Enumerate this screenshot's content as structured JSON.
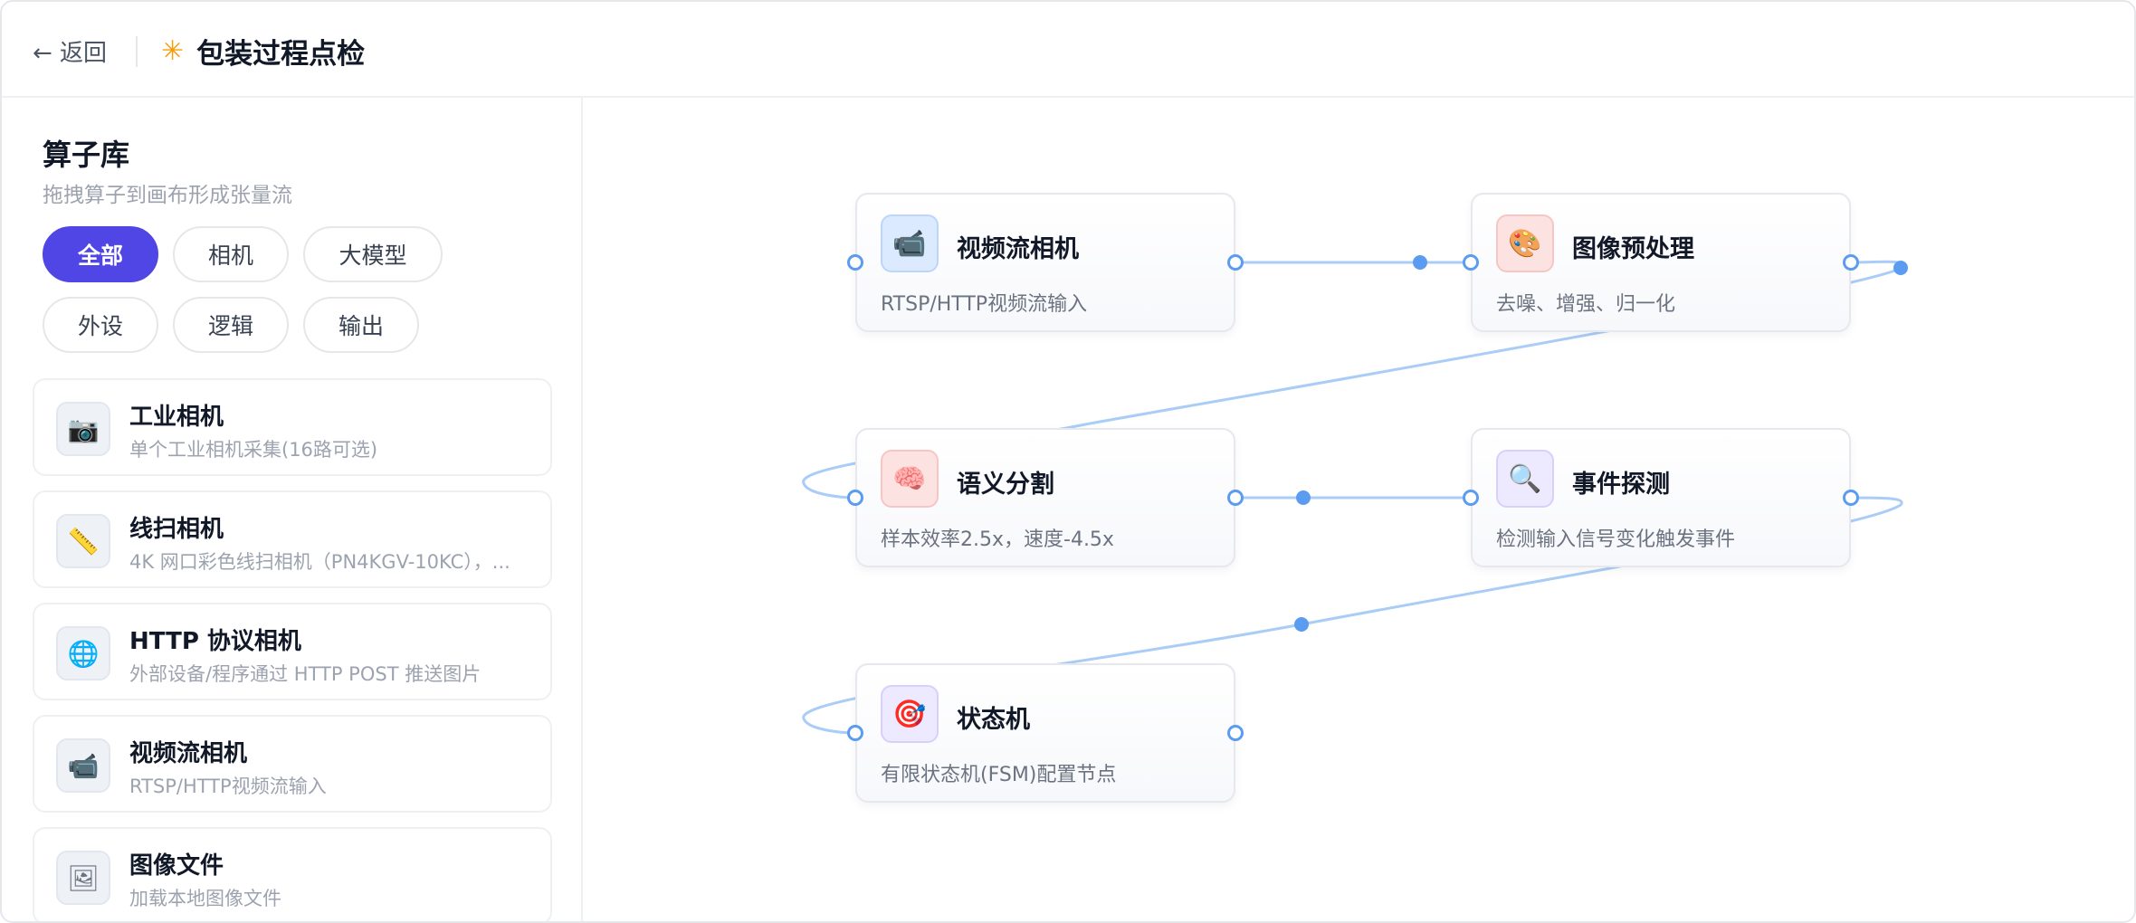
{
  "header": {
    "back_label": "← 返回",
    "title_icon": "sparkle-icon",
    "title": "包装过程点检"
  },
  "sidebar": {
    "title": "算子库",
    "subtitle": "拖拽算子到画布形成张量流",
    "filters": [
      {
        "label": "全部",
        "active": true
      },
      {
        "label": "相机",
        "active": false
      },
      {
        "label": "大模型",
        "active": false
      },
      {
        "label": "外设",
        "active": false
      },
      {
        "label": "逻辑",
        "active": false
      },
      {
        "label": "输出",
        "active": false
      }
    ],
    "operators": [
      {
        "icon": "camera-icon",
        "glyph": "📷",
        "name": "工业相机",
        "desc": "单个工业相机采集(16路可选)"
      },
      {
        "icon": "ruler-icon",
        "glyph": "📏",
        "name": "线扫相机",
        "desc": "4K 网口彩色线扫相机（PN4KGV-10KC），..."
      },
      {
        "icon": "globe-icon",
        "glyph": "🌐",
        "name": "HTTP 协议相机",
        "desc": "外部设备/程序通过 HTTP POST 推送图片"
      },
      {
        "icon": "video-camera-icon",
        "glyph": "📹",
        "name": "视频流相机",
        "desc": "RTSP/HTTP视频流输入"
      },
      {
        "icon": "picture-icon",
        "glyph": "🖼",
        "name": "图像文件",
        "desc": "加载本地图像文件"
      }
    ]
  },
  "canvas": {
    "nodes": [
      {
        "icon": "video-camera-icon",
        "glyph": "📹",
        "name": "视频流相机",
        "desc": "RTSP/HTTP视频流输入"
      },
      {
        "icon": "palette-icon",
        "glyph": "🎨",
        "name": "图像预处理",
        "desc": "去噪、增强、归一化"
      },
      {
        "icon": "brain-icon",
        "glyph": "🧠",
        "name": "语义分割",
        "desc": "样本效率2.5x，速度-4.5x"
      },
      {
        "icon": "magnifier-icon",
        "glyph": "🔍",
        "name": "事件探测",
        "desc": "检测输入信号变化触发事件"
      },
      {
        "icon": "target-icon",
        "glyph": "🎯",
        "name": "状态机",
        "desc": "有限状态机(FSM)配置节点"
      }
    ]
  },
  "colors": {
    "accent": "#4f46e5",
    "wire": "#93c5fd",
    "port": "#5b9cf0",
    "title_icon": "#f59e0b"
  }
}
